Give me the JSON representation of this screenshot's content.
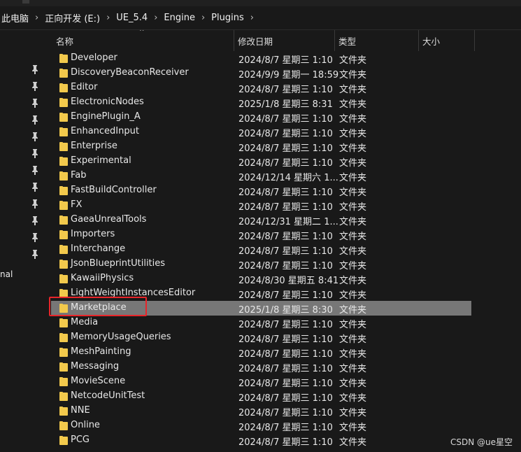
{
  "breadcrumb": [
    "此电脑",
    "正向开发 (E:)",
    "UE_5.4",
    "Engine",
    "Plugins"
  ],
  "breadcrumb_separator": "›",
  "nav_partial_label": "nal",
  "columns": {
    "name": "名称",
    "date": "修改日期",
    "type": "类型",
    "size": "大小"
  },
  "sort_indicator": "^",
  "files": [
    {
      "name": "Developer",
      "date": "2024/8/7 星期三 1:10",
      "type": "文件夹"
    },
    {
      "name": "DiscoveryBeaconReceiver",
      "date": "2024/9/9 星期一 18:59",
      "type": "文件夹"
    },
    {
      "name": "Editor",
      "date": "2024/8/7 星期三 1:10",
      "type": "文件夹"
    },
    {
      "name": "ElectronicNodes",
      "date": "2025/1/8 星期三 8:31",
      "type": "文件夹"
    },
    {
      "name": "EnginePlugin_A",
      "date": "2024/8/7 星期三 1:10",
      "type": "文件夹"
    },
    {
      "name": "EnhancedInput",
      "date": "2024/8/7 星期三 1:10",
      "type": "文件夹"
    },
    {
      "name": "Enterprise",
      "date": "2024/8/7 星期三 1:10",
      "type": "文件夹"
    },
    {
      "name": "Experimental",
      "date": "2024/8/7 星期三 1:10",
      "type": "文件夹"
    },
    {
      "name": "Fab",
      "date": "2024/12/14 星期六 1...",
      "type": "文件夹"
    },
    {
      "name": "FastBuildController",
      "date": "2024/8/7 星期三 1:10",
      "type": "文件夹"
    },
    {
      "name": "FX",
      "date": "2024/8/7 星期三 1:10",
      "type": "文件夹"
    },
    {
      "name": "GaeaUnrealTools",
      "date": "2024/12/31 星期二 1...",
      "type": "文件夹"
    },
    {
      "name": "Importers",
      "date": "2024/8/7 星期三 1:10",
      "type": "文件夹"
    },
    {
      "name": "Interchange",
      "date": "2024/8/7 星期三 1:10",
      "type": "文件夹"
    },
    {
      "name": "JsonBlueprintUtilities",
      "date": "2024/8/7 星期三 1:10",
      "type": "文件夹"
    },
    {
      "name": "KawaiiPhysics",
      "date": "2024/8/30 星期五 8:41",
      "type": "文件夹"
    },
    {
      "name": "LightWeightInstancesEditor",
      "date": "2024/8/7 星期三 1:10",
      "type": "文件夹"
    },
    {
      "name": "Marketplace",
      "date": "2025/1/8 星期三 8:30",
      "type": "文件夹",
      "selected": true
    },
    {
      "name": "Media",
      "date": "2024/8/7 星期三 1:10",
      "type": "文件夹"
    },
    {
      "name": "MemoryUsageQueries",
      "date": "2024/8/7 星期三 1:10",
      "type": "文件夹"
    },
    {
      "name": "MeshPainting",
      "date": "2024/8/7 星期三 1:10",
      "type": "文件夹"
    },
    {
      "name": "Messaging",
      "date": "2024/8/7 星期三 1:10",
      "type": "文件夹"
    },
    {
      "name": "MovieScene",
      "date": "2024/8/7 星期三 1:10",
      "type": "文件夹"
    },
    {
      "name": "NetcodeUnitTest",
      "date": "2024/8/7 星期三 1:10",
      "type": "文件夹"
    },
    {
      "name": "NNE",
      "date": "2024/8/7 星期三 1:10",
      "type": "文件夹"
    },
    {
      "name": "Online",
      "date": "2024/8/7 星期三 1:10",
      "type": "文件夹"
    },
    {
      "name": "PCG",
      "date": "2024/8/7 星期三 1:10",
      "type": "文件夹"
    }
  ],
  "colors": {
    "folder": "#f2c94c",
    "selected_row": "#777777",
    "annotation_box": "#e8252a"
  },
  "icons": {
    "folder": "folder-icon",
    "pin": "pin-icon"
  },
  "watermark": "CSDN @ue星空"
}
